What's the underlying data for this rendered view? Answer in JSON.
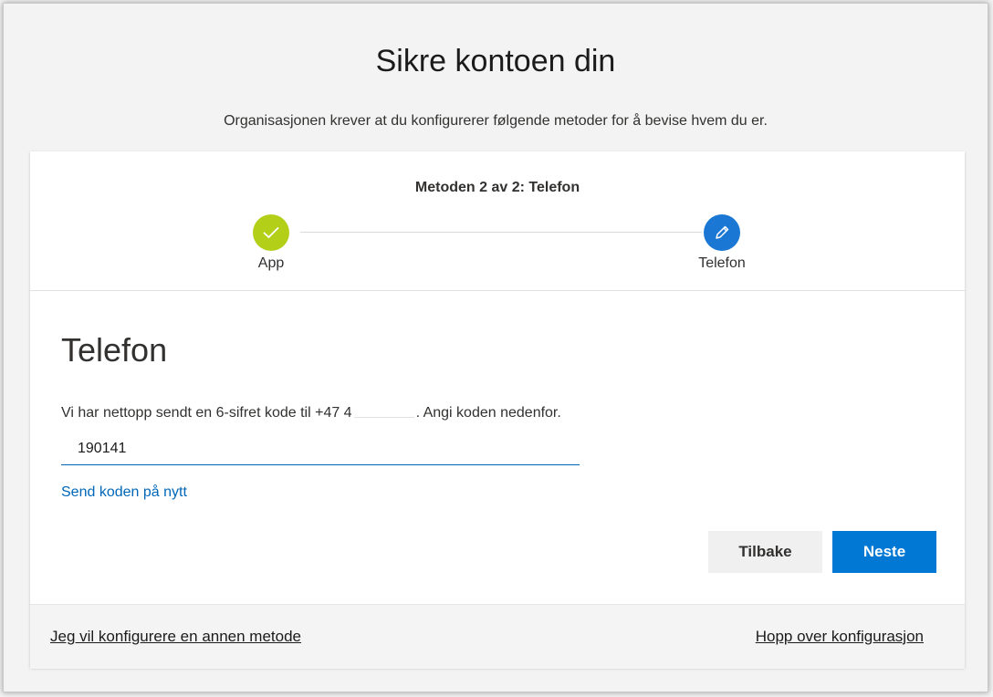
{
  "header": {
    "title": "Sikre kontoen din",
    "subtitle": "Organisasjonen krever at du konfigurerer følgende metoder for å bevise hvem du er."
  },
  "progress": {
    "label": "Metoden 2 av 2: Telefon",
    "steps": [
      {
        "label": "App",
        "state": "completed",
        "icon": "checkmark-icon",
        "color": "#b4cf18"
      },
      {
        "label": "Telefon",
        "state": "current",
        "icon": "pencil-icon",
        "color": "#1a78d4"
      }
    ]
  },
  "main": {
    "section_title": "Telefon",
    "instruction_prefix": "Vi har nettopp sendt en 6-sifret kode til +47 4",
    "instruction_suffix": ". Angi koden nedenfor.",
    "code_value": "190141",
    "resend_link": "Send koden på nytt",
    "back_button": "Tilbake",
    "next_button": "Neste"
  },
  "footer": {
    "other_method_link": "Jeg vil konfigurere en annen metode",
    "skip_link": "Hopp over konfigurasjon"
  },
  "colors": {
    "accent": "#0078d4",
    "link": "#0067b8",
    "completed_step": "#b4cf18"
  }
}
